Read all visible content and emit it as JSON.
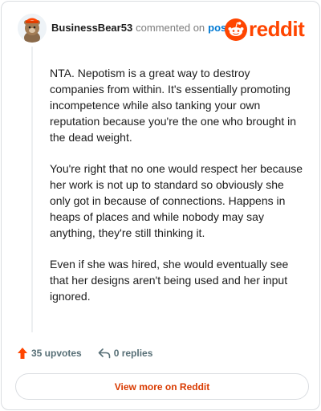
{
  "header": {
    "username": "BusinessBear53",
    "action": "commented on",
    "post_link": "post",
    "brand": "reddit"
  },
  "comment": {
    "paragraphs": [
      "NTA. Nepotism is a great way to destroy companies from within. It's essentially promoting incompetence while also tanking your own reputation because you're the one who brought in the dead weight.",
      "You're right that no one would respect her because her work is not up to standard so obviously she only got in because of connections. Happens in heaps of places and while nobody may say anything, they're still thinking it.",
      "Even if she was hired, she would eventually see that her designs aren't being used and her input ignored."
    ]
  },
  "stats": {
    "upvotes": "35 upvotes",
    "replies": "0 replies"
  },
  "footer": {
    "view_button": "View more on Reddit"
  },
  "colors": {
    "brand": "#ff4500",
    "link": "#0079d3",
    "button_text": "#d93a00"
  },
  "icons": [
    "avatar",
    "reddit-logo-icon",
    "upvote-arrow-icon",
    "reply-arrow-icon"
  ]
}
